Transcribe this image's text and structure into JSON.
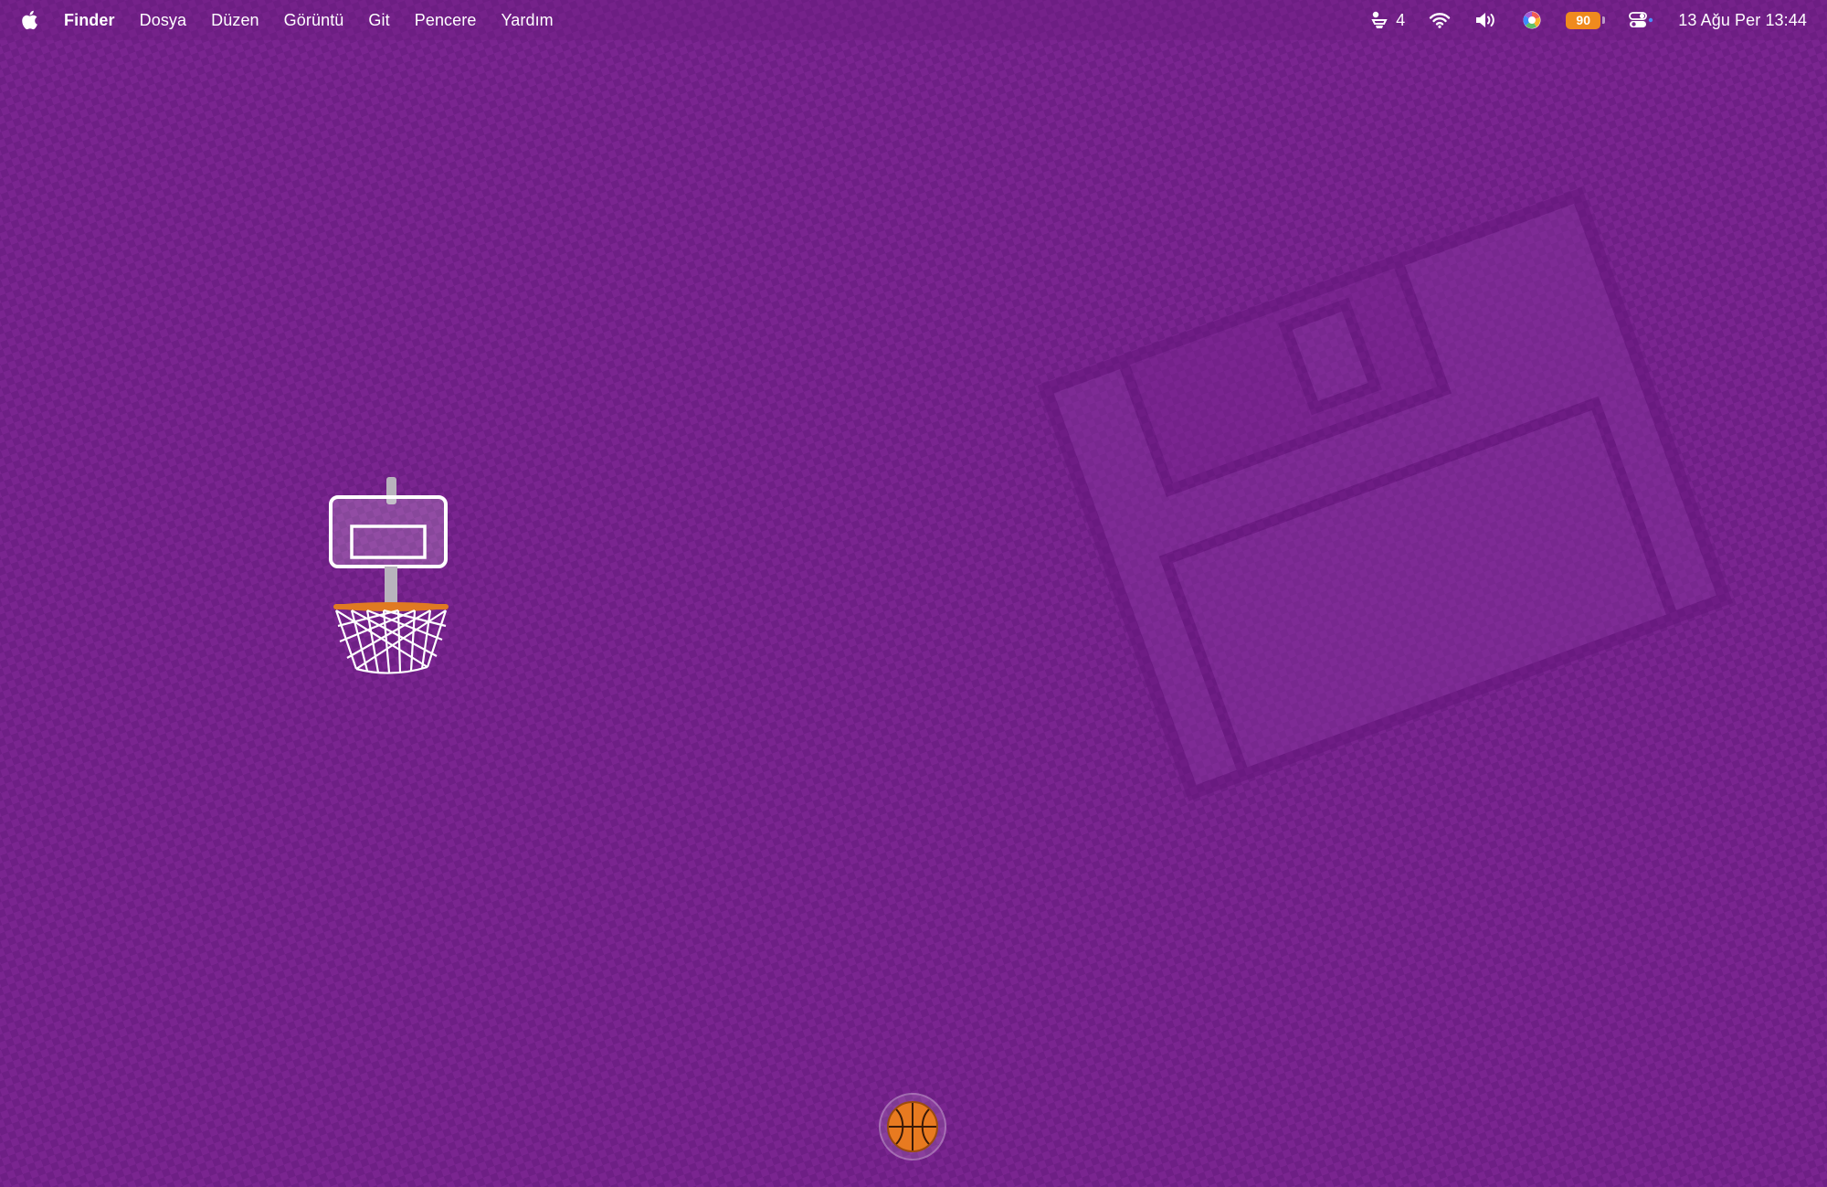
{
  "menubar": {
    "app_name": "Finder",
    "menus": [
      "Dosya",
      "Düzen",
      "Görüntü",
      "Git",
      "Pencere",
      "Yardım"
    ]
  },
  "status": {
    "notifications_count": "4",
    "battery_label": "90",
    "clock": "13 Ağu Per  13:44"
  },
  "icons": {
    "apple": "apple-icon",
    "notifications": "notification-icon",
    "wifi": "wifi-icon",
    "volume": "volume-icon",
    "color_picker": "color-wheel-icon",
    "battery": "battery-icon",
    "control_center": "control-center-icon",
    "hoop": "basketball-hoop-icon",
    "ball": "basketball-icon"
  },
  "colors": {
    "desktop_background": "#7a2590",
    "battery": "#f08a1e",
    "ball": "#e87a20",
    "rim": "#e07a22"
  }
}
